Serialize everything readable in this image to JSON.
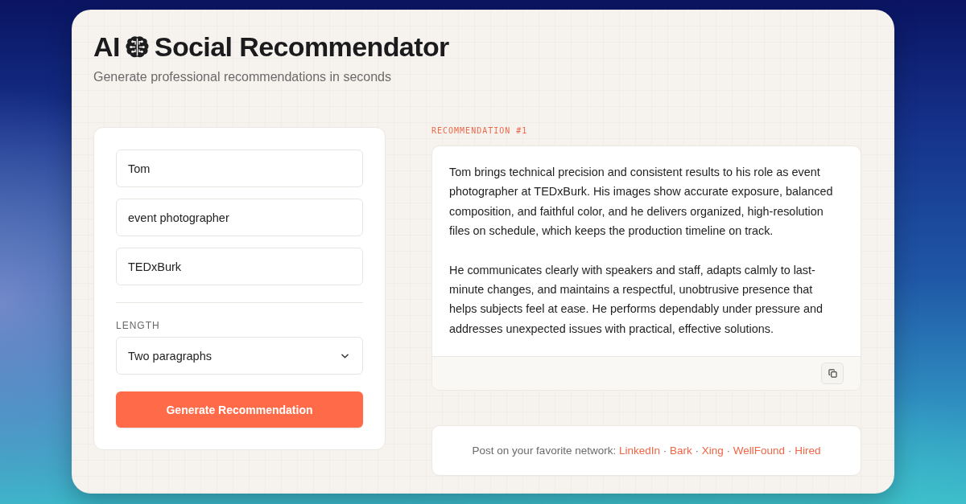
{
  "header": {
    "title_start": "AI",
    "title_end": "Social Recommendator",
    "subtitle": "Generate professional recommendations in seconds"
  },
  "form": {
    "fields": [
      {
        "value": "Tom"
      },
      {
        "value": "event photographer"
      },
      {
        "value": "TEDxBurk"
      }
    ],
    "length": {
      "label": "LENGTH",
      "value": "Two paragraphs"
    },
    "submit": "Generate Recommendation"
  },
  "recommendation": {
    "label": "RECOMMENDATION #1",
    "paragraphs": [
      "Tom brings technical precision and consistent results to his role as event photographer at TEDxBurk. His images show accurate exposure, balanced composition, and faithful color, and he delivers organized, high-resolution files on schedule, which keeps the production timeline on track.",
      "He communicates clearly with speakers and staff, adapts calmly to last-minute changes, and maintains a respectful, unobtrusive presence that helps subjects feel at ease. He performs dependably under pressure and addresses unexpected issues with practical, effective solutions."
    ]
  },
  "share": {
    "prompt": "Post on your favorite network:",
    "separator": "·",
    "links": [
      "LinkedIn",
      "Bark",
      "Xing",
      "WellFound",
      "Hired"
    ]
  }
}
